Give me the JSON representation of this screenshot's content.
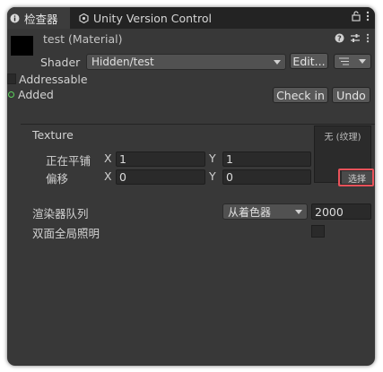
{
  "tabs": [
    {
      "label": "检查器",
      "icon": "info-icon",
      "active": true
    },
    {
      "label": "Unity Version Control",
      "icon": "version-control-icon",
      "active": false
    }
  ],
  "material": {
    "title": "test (Material)",
    "shader_label": "Shader",
    "shader_value": "Hidden/test",
    "edit_label": "Edit...",
    "swatch_color": "#000000"
  },
  "addressable": {
    "label": "Addressable",
    "checked": false
  },
  "vcs": {
    "status_label": "Added",
    "status_color": "#5cd35c",
    "checkin_label": "Check in",
    "undo_label": "Undo"
  },
  "texture": {
    "label": "Texture",
    "none_text": "无 (纹理)",
    "select_label": "选择",
    "tiling": {
      "label": "正在平铺",
      "x_axis": "X",
      "x_value": "1",
      "y_axis": "Y",
      "y_value": "1"
    },
    "offset": {
      "label": "偏移",
      "x_axis": "X",
      "x_value": "0",
      "y_axis": "Y",
      "y_value": "0"
    }
  },
  "render_queue": {
    "label": "渲染器队列",
    "mode": "从着色器",
    "value": "2000"
  },
  "double_sided_gi": {
    "label": "双面全局照明",
    "checked": false
  },
  "colors": {
    "highlight": "#e8525a",
    "panel": "#383838",
    "tabbar": "#232323"
  }
}
